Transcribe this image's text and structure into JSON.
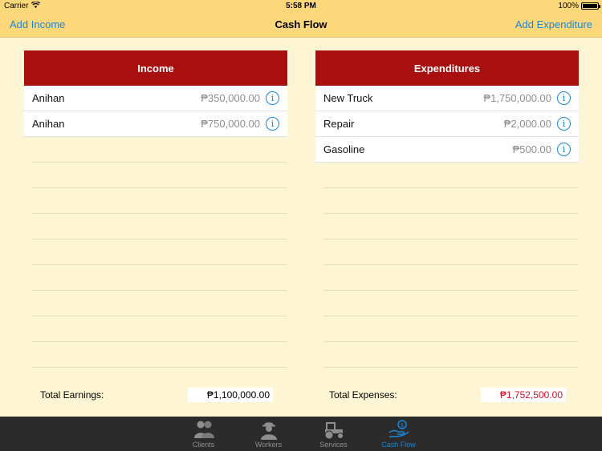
{
  "status_bar": {
    "carrier": "Carrier",
    "time": "5:58 PM",
    "battery": "100%"
  },
  "nav": {
    "left_button": "Add Income",
    "title": "Cash Flow",
    "right_button": "Add Expenditure"
  },
  "income": {
    "header": "Income",
    "rows": [
      {
        "name": "Anihan",
        "amount": "₱350,000.00"
      },
      {
        "name": "Anihan",
        "amount": "₱750,000.00"
      }
    ],
    "total_label": "Total Earnings:",
    "total_value": "₱1,100,000.00"
  },
  "expenditures": {
    "header": "Expenditures",
    "rows": [
      {
        "name": "New Truck",
        "amount": "₱1,750,000.00"
      },
      {
        "name": "Repair",
        "amount": "₱2,000.00"
      },
      {
        "name": "Gasoline",
        "amount": "₱500.00"
      }
    ],
    "total_label": "Total Expenses:",
    "total_value": "₱1,752,500.00"
  },
  "colors": {
    "accent": "#1a86d8",
    "header_red": "#a90f0f",
    "expense_total": "#d0112b",
    "nav_bg": "#fcd87a",
    "page_bg": "#fdf5d3"
  },
  "tabs": [
    {
      "label": "Clients",
      "icon": "clients-icon",
      "active": false
    },
    {
      "label": "Workers",
      "icon": "worker-icon",
      "active": false
    },
    {
      "label": "Services",
      "icon": "tractor-icon",
      "active": false
    },
    {
      "label": "Cash Flow",
      "icon": "cash-hand-icon",
      "active": true
    }
  ]
}
